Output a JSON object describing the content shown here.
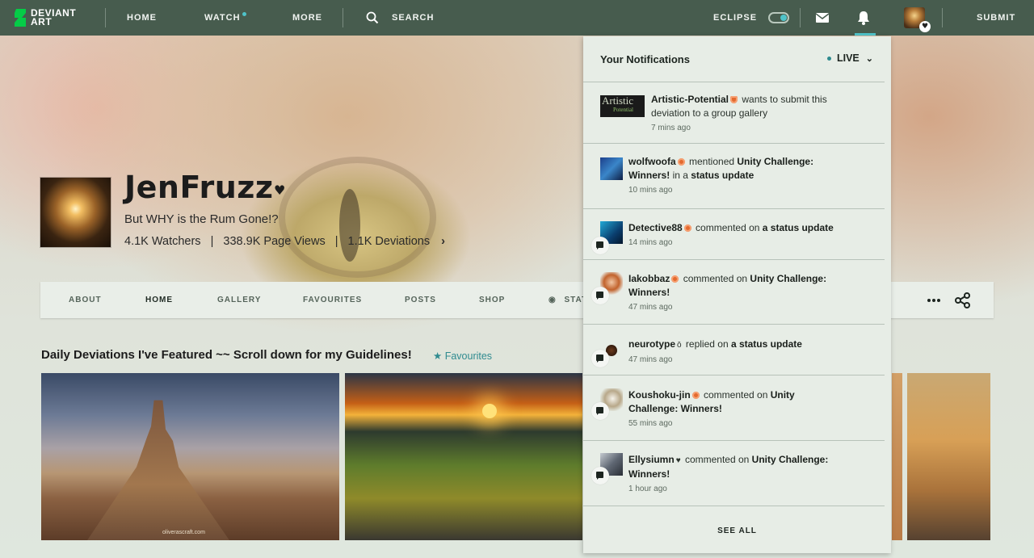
{
  "topbar": {
    "logo_line1": "DEVIANT",
    "logo_line2": "ART",
    "home": "HOME",
    "watch": "WATCH",
    "more": "MORE",
    "search": "SEARCH",
    "eclipse": "ECLIPSE",
    "submit": "SUBMIT"
  },
  "profile": {
    "name": "JenFruzz",
    "tagline": "But WHY is the Rum Gone!?",
    "watchers": "4.1K Watchers",
    "page_views": "338.9K Page Views",
    "deviations": "1.1K Deviations",
    "separator": "|"
  },
  "profile_nav": {
    "about": "ABOUT",
    "home": "HOME",
    "gallery": "GALLERY",
    "favourites": "FAVOURITES",
    "posts": "POSTS",
    "shop": "SHOP",
    "stats": "STAT"
  },
  "daily": {
    "title": "Daily Deviations I've Featured ~~ Scroll down for my Guidelines!",
    "favourites_link": "Favourites",
    "watermark": "oliverascraft.com"
  },
  "notifications": {
    "title": "Your Notifications",
    "mode": "LIVE",
    "items": [
      {
        "user": "Artistic-Potential",
        "action": " wants to submit this deviation to a group gallery",
        "target": "",
        "target2": "",
        "time": "7 mins ago"
      },
      {
        "user": "wolfwoofa",
        "action": " mentioned ",
        "target": "Unity Challenge: Winners!",
        "middle": " in a ",
        "target2": "status update",
        "time": "10 mins ago"
      },
      {
        "user": "Detective88",
        "action": " commented on ",
        "target": "a status update",
        "time": "14 mins ago"
      },
      {
        "user": "Iakobbaz",
        "action": " commented on ",
        "target": "Unity Challenge: Winners!",
        "time": "47 mins ago"
      },
      {
        "user": "neurotype",
        "action": " replied on ",
        "target": "a status update",
        "time": "47 mins ago"
      },
      {
        "user": "Koushoku-jin",
        "action": " commented on ",
        "target": "Unity Challenge: Winners!",
        "time": "55 mins ago"
      },
      {
        "user": "Ellysiumn",
        "action": " commented on ",
        "target": "Unity Challenge: Winners!",
        "time": "1 hour ago"
      }
    ],
    "see_all": "SEE ALL",
    "avatar_text_1": "Artistic",
    "avatar_text_2": "Potential"
  },
  "colors": {
    "topbar": "#475c4e",
    "accent": "#4fc3c9",
    "link": "#2f8b8f",
    "badge": "#e36a2f"
  }
}
